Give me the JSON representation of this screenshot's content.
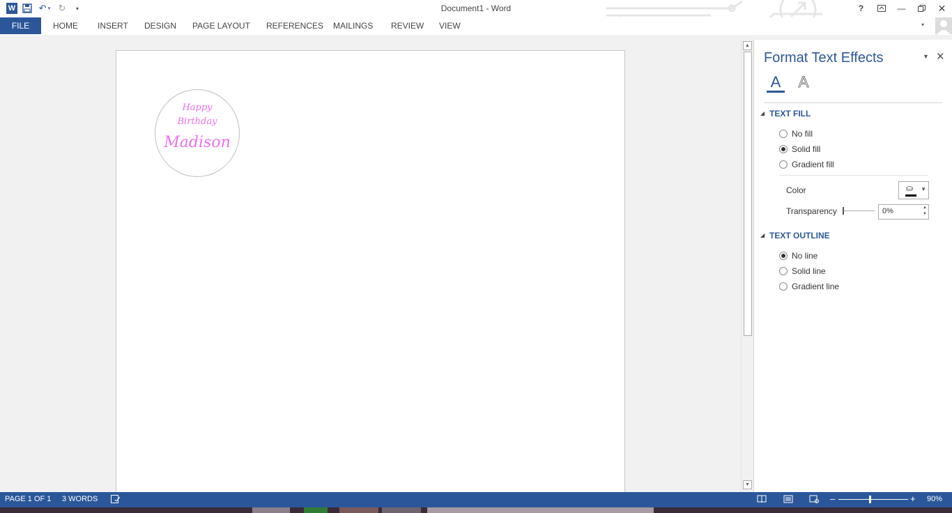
{
  "app": {
    "title": "Document1 - Word"
  },
  "ribbon": {
    "tabs": [
      "FILE",
      "HOME",
      "INSERT",
      "DESIGN",
      "PAGE LAYOUT",
      "REFERENCES",
      "MAILINGS",
      "REVIEW",
      "VIEW"
    ]
  },
  "document": {
    "sticker": {
      "line1": "Happy",
      "line2": "Birthday",
      "line3": "Madison",
      "text_color": "#f070ee"
    }
  },
  "pane": {
    "title": "Format Text Effects",
    "text_fill": {
      "heading": "TEXT FILL",
      "options": [
        "No fill",
        "Solid fill",
        "Gradient fill"
      ],
      "selected": "Solid fill",
      "color_label": "Color",
      "transparency_label": "Transparency",
      "transparency_value": "0%"
    },
    "text_outline": {
      "heading": "TEXT OUTLINE",
      "options": [
        "No line",
        "Solid line",
        "Gradient line"
      ],
      "selected": "No line"
    }
  },
  "statusbar": {
    "page": "PAGE 1 OF 1",
    "words": "3 WORDS",
    "zoom": "90%"
  },
  "colors": {
    "accent": "#2b579a"
  },
  "icons": [
    "word-logo-icon",
    "save-icon",
    "undo-icon",
    "redo-icon",
    "customize-icon",
    "help-icon",
    "ribbon-display-icon",
    "minimize-icon",
    "restore-icon",
    "close-icon",
    "user-icon",
    "text-fill-icon",
    "text-outline-icon",
    "pane-options-icon",
    "pane-close-icon",
    "paint-bucket-icon",
    "read-mode-icon",
    "print-layout-icon",
    "web-layout-icon",
    "proofing-icon",
    "zoom-out-icon",
    "zoom-in-icon"
  ]
}
